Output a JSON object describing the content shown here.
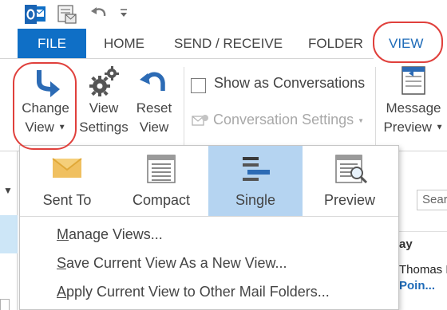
{
  "tabs": {
    "file": "FILE",
    "home": "HOME",
    "send_receive": "SEND / RECEIVE",
    "folder": "FOLDER",
    "view": "VIEW"
  },
  "ribbon": {
    "change_view": [
      "Change",
      "View"
    ],
    "view_settings": [
      "View",
      "Settings"
    ],
    "reset_view": [
      "Reset",
      "View"
    ],
    "show_as_conversations": "Show as Conversations",
    "conversation_settings": "Conversation Settings",
    "message_preview": [
      "Message",
      "Preview"
    ]
  },
  "menu": {
    "gallery": [
      {
        "label": "Sent To",
        "icon": "envelope-icon"
      },
      {
        "label": "Compact",
        "icon": "compact-list-icon"
      },
      {
        "label": "Single",
        "icon": "single-line-icon",
        "selected": true
      },
      {
        "label": "Preview",
        "icon": "preview-icon"
      }
    ],
    "manage_views": {
      "accel": "M",
      "rest": "anage Views..."
    },
    "save_view": {
      "accel": "S",
      "rest": "ave Current View As a New View..."
    },
    "apply_view": {
      "accel": "A",
      "rest": "pply Current View to Other Mail Folders..."
    }
  },
  "mail_list": {
    "search_placeholder": "Sear",
    "column_header": "ay",
    "sender": "Thomas L",
    "subject": "Poin..."
  },
  "colors": {
    "accent": "#0f6fc6",
    "annotation": "#e0403c",
    "selected_gallery": "#b5d4f1"
  }
}
